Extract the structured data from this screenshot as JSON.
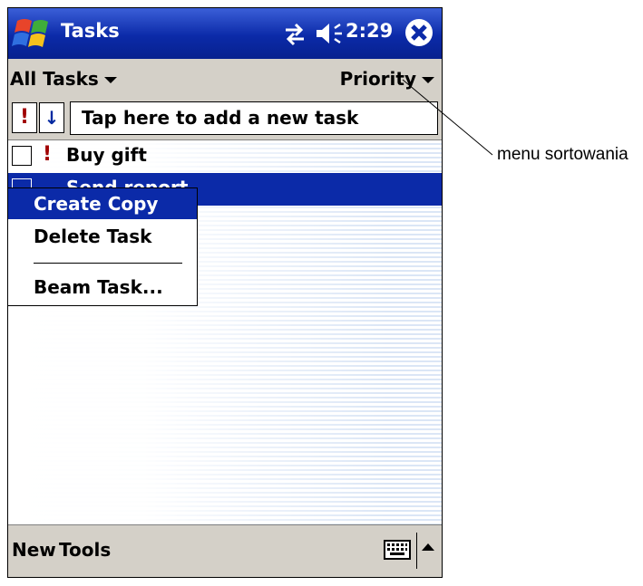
{
  "titlebar": {
    "title": "Tasks",
    "time": "2:29"
  },
  "filterbar": {
    "filter_label": "All Tasks",
    "sort_label": "Priority"
  },
  "entrybar": {
    "priority_symbol": "!",
    "sort_direction_symbol": "↓",
    "new_task_text": "Tap here to add a new task"
  },
  "tasks": [
    {
      "name": "Buy gift",
      "priority_mark": "!",
      "checked": false,
      "selected": false
    },
    {
      "name": "Send report",
      "priority_mark": "",
      "checked": false,
      "selected": true
    }
  ],
  "context_menu": {
    "items": [
      "Create Copy",
      "Delete Task",
      "Beam Task..."
    ],
    "highlighted_index": 0
  },
  "commandbar": {
    "new_label": "New",
    "tools_label": "Tools"
  },
  "callout": {
    "label": "menu sortowania"
  },
  "colors": {
    "titlebar": "#0b2aa8",
    "selection": "#0b2aa8",
    "bars": "#d4d0c8",
    "priority": "#a00000"
  },
  "icons": [
    "windows-start-icon",
    "sync-icon",
    "speaker-icon",
    "close-icon",
    "keyboard-icon",
    "sip-arrow-icon"
  ]
}
